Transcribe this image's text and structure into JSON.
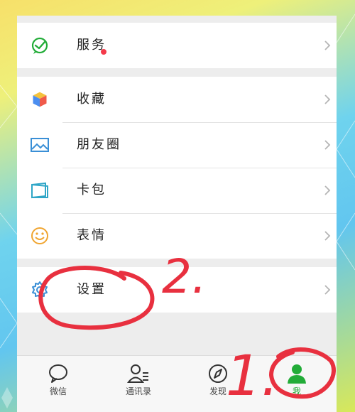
{
  "menu": {
    "services": {
      "label": "服务",
      "icon": "wechat-pay-icon"
    },
    "favorites": {
      "label": "收藏",
      "icon": "cube-icon"
    },
    "moments": {
      "label": "朋友圈",
      "icon": "picture-icon"
    },
    "cards": {
      "label": "卡包",
      "icon": "wallet-card-icon"
    },
    "stickers": {
      "label": "表情",
      "icon": "smiley-icon"
    },
    "settings": {
      "label": "设置",
      "icon": "gear-icon"
    }
  },
  "tabs": [
    {
      "label": "微信",
      "icon": "chat-bubble-icon"
    },
    {
      "label": "通讯录",
      "icon": "contacts-icon"
    },
    {
      "label": "发现",
      "icon": "compass-icon"
    },
    {
      "label": "我",
      "icon": "person-icon"
    }
  ],
  "annotations": {
    "step1": "1.",
    "step2": "2."
  },
  "colors": {
    "accent": "#22ac38",
    "badge": "#f43a4a",
    "annotation": "#e8303f"
  }
}
